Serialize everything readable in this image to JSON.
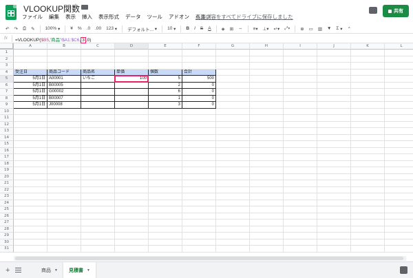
{
  "app": {
    "title": "VLOOKUP関数",
    "menu": [
      "ファイル",
      "編集",
      "表示",
      "挿入",
      "表示形式",
      "データ",
      "ツール",
      "アドオン",
      "ヘルプ"
    ],
    "save_status": "変更内容をすべてドライブに保存しました",
    "share_label": "共有",
    "brand_color": "#0f9d58"
  },
  "toolbar": {
    "zoom": "100%",
    "currency": "¥",
    "percent": "%",
    "dec_less": ".0",
    "dec_more": ".00",
    "more_formats": "123",
    "font": "デフォルト...",
    "font_size": "10",
    "bold": "B",
    "italic": "I",
    "strike": "S",
    "text_color": "A",
    "link": "⊕",
    "sum": "Σ"
  },
  "formula_bar": {
    "fx": "fx",
    "prefix": "=VLOOKUP(",
    "ref1": "$B5",
    "comma1": ",",
    "sheet": "'商品'",
    "range": "!$A1:$C6",
    "comma2": ",",
    "col_index": "3",
    "suffix": ",0)"
  },
  "columns": [
    "A",
    "B",
    "C",
    "D",
    "E",
    "F",
    "G",
    "H",
    "I",
    "J",
    "K",
    "L"
  ],
  "rows": [
    "1",
    "2",
    "3",
    "4",
    "5",
    "6",
    "7",
    "8",
    "9",
    "10",
    "11",
    "12",
    "13",
    "14",
    "15",
    "16",
    "17",
    "18",
    "19",
    "20",
    "21",
    "22",
    "23",
    "24",
    "25",
    "26",
    "27",
    "28",
    "29",
    "30",
    "31"
  ],
  "table": {
    "headers": [
      "受注日",
      "商品コード",
      "商品名",
      "単価",
      "個数",
      "合計"
    ],
    "rows": [
      [
        "5月1日",
        "A00001",
        "いちご",
        "100",
        "5",
        "500"
      ],
      [
        "5月1日",
        "B00005",
        "",
        "",
        "2",
        "0"
      ],
      [
        "5月1日",
        "G00002",
        "",
        "",
        "6",
        "0"
      ],
      [
        "5月1日",
        "B00007",
        "",
        "",
        "1",
        "0"
      ],
      [
        "5月1日",
        "J00008",
        "",
        "",
        "3",
        "0"
      ]
    ]
  },
  "sheets": [
    {
      "name": "商品",
      "active": false
    },
    {
      "name": "見積書",
      "active": true
    }
  ]
}
